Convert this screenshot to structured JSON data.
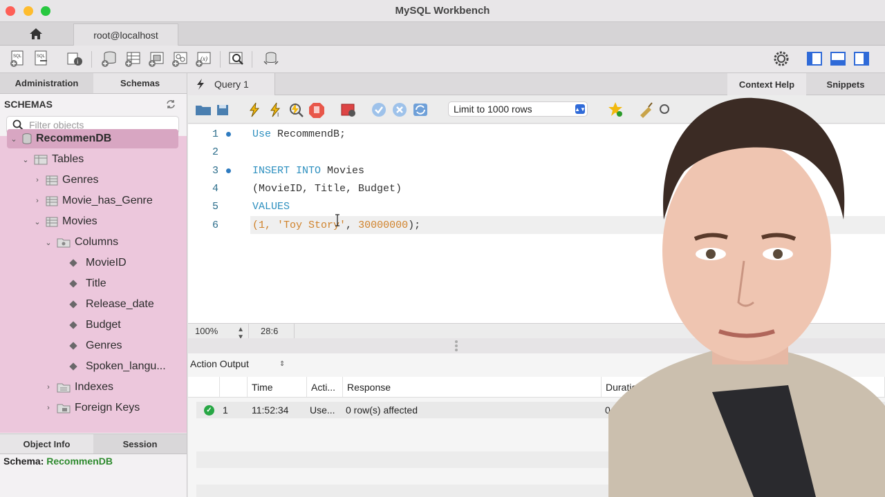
{
  "window": {
    "title": "MySQL Workbench"
  },
  "connection_tab": {
    "label": "root@localhost"
  },
  "left_panel": {
    "tabs": [
      "Administration",
      "Schemas"
    ],
    "header": "SCHEMAS",
    "filter_placeholder": "Filter objects",
    "tree": {
      "schema": "RecommenDB",
      "tables": "Tables",
      "genres": "Genres",
      "movie_has_genre": "Movie_has_Genre",
      "movies": "Movies",
      "columns": "Columns",
      "col_movieid": "MovieID",
      "col_title": "Title",
      "col_release_date": "Release_date",
      "col_budget": "Budget",
      "col_genres": "Genres",
      "col_spoken": "Spoken_langu...",
      "indexes": "Indexes",
      "foreign_keys": "Foreign Keys"
    },
    "bottom_tabs": [
      "Object Info",
      "Session"
    ],
    "object_info": {
      "label": "Schema:",
      "value": "RecommenDB"
    }
  },
  "query_tabs": {
    "active": "Query 1",
    "right_tabs": [
      "Context Help",
      "Snippets"
    ]
  },
  "editor_toolbar": {
    "limit_select": "Limit to 1000 rows"
  },
  "editor": {
    "line_numbers": [
      "1",
      "2",
      "3",
      "4",
      "5",
      "6"
    ],
    "lines": {
      "l1_kw": "Use",
      "l1_rest": " RecommendB;",
      "l3_kw": "INSERT INTO",
      "l3_rest": " Movies",
      "l4": "(MovieID, Title, Budget)",
      "l5_kw": "VALUES",
      "l6_a": "(1, ",
      "l6_str": "'Toy Story'",
      "l6_b": ", ",
      "l6_num": "30000000",
      "l6_c": ");"
    },
    "zoom": "100%",
    "cursor_position": "28:6"
  },
  "output": {
    "selector": "Action Output",
    "columns": [
      "Time",
      "Acti...",
      "Response",
      "Duration /"
    ],
    "rows": [
      {
        "num": "1",
        "time": "11:52:34",
        "action": "Use...",
        "response": "0 row(s) affected",
        "duration": "0.00078 se"
      }
    ]
  },
  "colors": {
    "tree_bg": "#ecc7dc",
    "selection": "#d8a6c2",
    "keyword": "#2c8fbf",
    "string": "#d0822a"
  }
}
